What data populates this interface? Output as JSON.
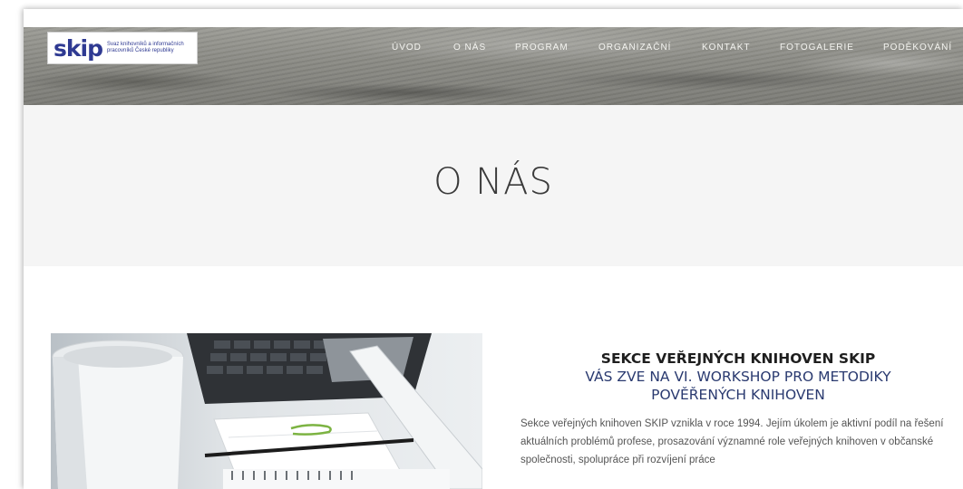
{
  "logo": {
    "mark": "skip",
    "subtitle": "Svaz knihovníků a informačních pracovníků České republiky"
  },
  "nav": {
    "items": [
      {
        "label": "ÚVOD"
      },
      {
        "label": "O NÁS"
      },
      {
        "label": "PROGRAM"
      },
      {
        "label": "ORGANIZAČNÍ"
      },
      {
        "label": "KONTAKT"
      },
      {
        "label": "FOTOGALERIE"
      },
      {
        "label": "PODĚKOVÁNÍ"
      }
    ]
  },
  "page": {
    "title": "O NÁS"
  },
  "article": {
    "heading_line1": "SEKCE VEŘEJNÝCH KNIHOVEN SKIP",
    "heading_line2": "VÁS ZVE NA VI. WORKSHOP PRO METODIKY",
    "heading_line3": "POVĚŘENÝCH KNIHOVEN",
    "body": "Sekce veřejných knihoven SKIP vznikla v roce 1994. Jejím úkolem je aktivní podíl na řešení aktuálních problémů profese, prosazování významné role veřejných knihoven v občanské společnosti, spolupráce při rozvíjení práce"
  }
}
